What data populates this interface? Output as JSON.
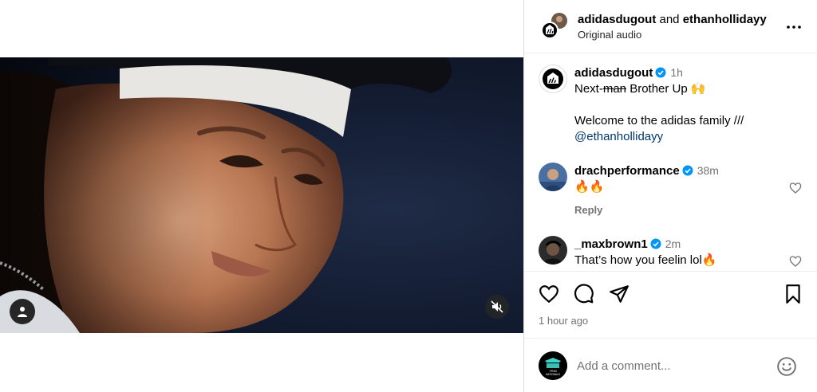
{
  "post": {
    "author": "adidasdugout",
    "collab_and": "and",
    "collaborator": "ethanhollidayy",
    "audio": "Original audio",
    "time_ago": "1 hour ago"
  },
  "caption": {
    "user": "adidasdugout",
    "time": "1h",
    "line1_prefix": "Next-",
    "line1_struck": "man",
    "line1_suffix": " Brother Up 🙌",
    "line2": "Welcome to the adidas family ///",
    "mention": "@ethanhollidayy"
  },
  "comments": [
    {
      "user": "drachperformance",
      "time": "38m",
      "text": "🔥🔥",
      "reply": "Reply"
    },
    {
      "user": "_maxbrown1",
      "time": "2m",
      "text": "That’s how you feelin lol🔥"
    }
  ],
  "add_comment": {
    "placeholder": "Add a comment...",
    "avatar_text_top": "TRIN",
    "avatar_text_bottom": "NATIONALS"
  },
  "colors": {
    "accent_blue": "#0095f6",
    "mention": "#00376b",
    "muted": "#737373",
    "border": "#dbdbdb"
  },
  "icons": [
    "person-icon",
    "muted-speaker-icon",
    "more-icon",
    "verified-icon",
    "heart-icon",
    "comment-icon",
    "share-icon",
    "bookmark-icon",
    "emoji-icon"
  ]
}
